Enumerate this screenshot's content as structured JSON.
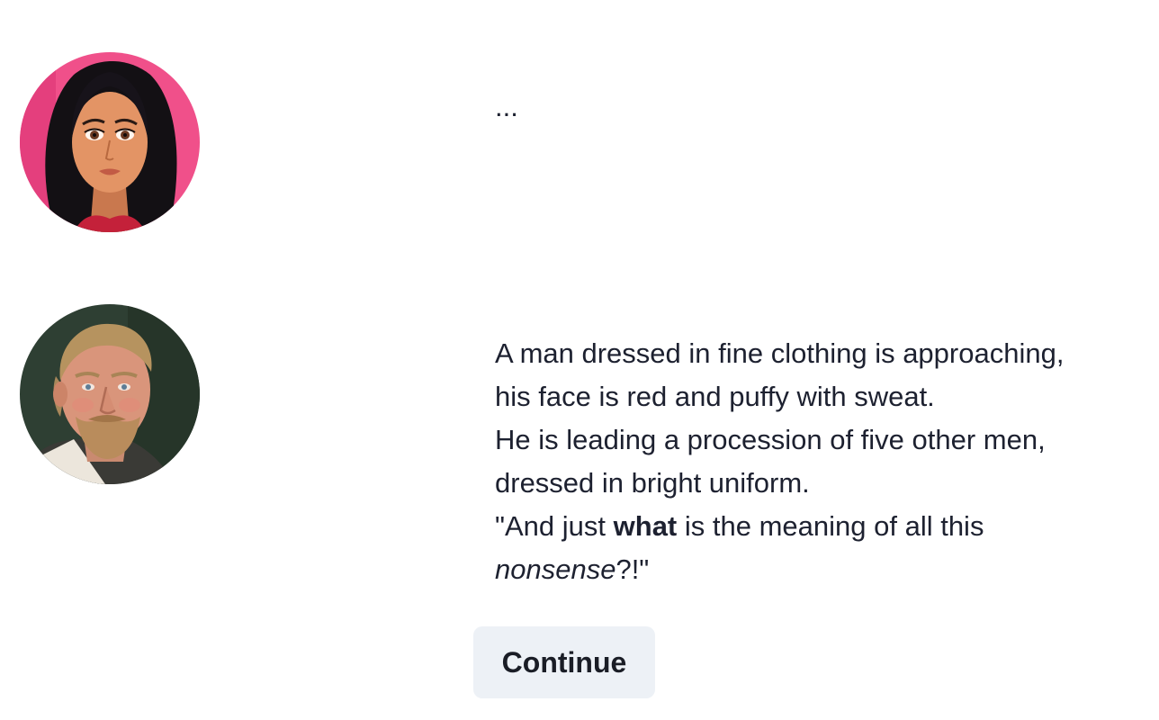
{
  "story": {
    "entries": [
      {
        "avatar_icon": "woman-portrait-icon",
        "lines": [
          "..."
        ]
      },
      {
        "avatar_icon": "old-man-portrait-icon",
        "lines": [
          "A man dressed in fine clothing is approaching,",
          "his face is red and puffy with sweat.",
          "He is leading a procession of five other men,",
          "dressed in bright uniform."
        ],
        "quote": {
          "part1": "\"And just ",
          "bold": "what",
          "part2": " is the meaning of all this",
          "italic": "nonsense",
          "part3": "?!\""
        }
      }
    ]
  },
  "actions": {
    "continue_label": "Continue"
  },
  "colors": {
    "text": "#1d2130",
    "button_bg": "#edf1f6",
    "woman_bg": "#f0508a",
    "man_bg": "#2e3f33"
  }
}
